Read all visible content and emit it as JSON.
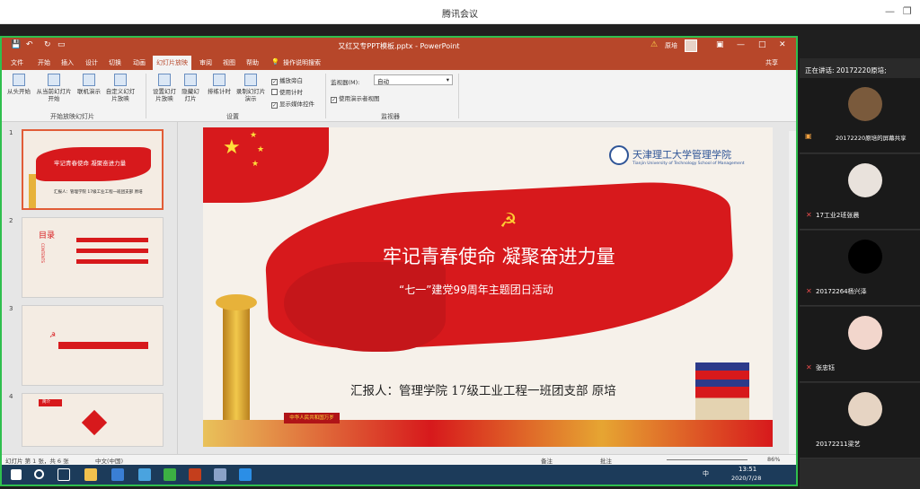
{
  "window": {
    "title": "腾讯会议",
    "minimize_icon": "minimize-icon",
    "restore_icon": "restore-icon"
  },
  "ppt": {
    "doc_title": "又红又专PPT模板.pptx - PowerPoint",
    "user": "原培",
    "share": "共享",
    "tell_me": "操作说明搜索",
    "tabs": [
      "文件",
      "开始",
      "插入",
      "设计",
      "切换",
      "动画",
      "幻灯片放映",
      "审阅",
      "视图",
      "帮助"
    ],
    "active_tab": "幻灯片放映",
    "ribbon": {
      "from_start": "从头开始",
      "from_current": "从当前幻灯片开始",
      "online": "联机演示",
      "custom": "自定义幻灯片放映",
      "group1": "开始放映幻灯片",
      "setup": "设置幻灯片放映",
      "hide": "隐藏幻灯片",
      "rehearse": "排练计时",
      "record": "录制幻灯片演示",
      "cb_narration": "播放旁白",
      "cb_timing": "使用计时",
      "cb_media": "显示媒体控件",
      "group2": "设置",
      "monitor_label": "监视器(M):",
      "monitor_value": "自动",
      "presenter_view": "使用演示者视图",
      "group3": "监视器"
    },
    "thumb_numbers": [
      "1",
      "2",
      "3",
      "4"
    ],
    "thumb1_title": "牢记青春使命  凝聚奋进力量",
    "thumb1_sub": "汇报人：管理学院  17级工业工程一班团支部  原培",
    "thumb2_label": "目录",
    "thumb2_sub": "CONTENTS",
    "thumb4_label": "简介",
    "slide": {
      "logo_text": "天津理工大学管理学院",
      "logo_sub": "Tianjin University of Technology School of Management",
      "title": "牢记青春使命    凝聚奋进力量",
      "subtitle": "“七一”建党99周年主题团日活动",
      "reporter": "汇报人：管理学院  17级工业工程一班团支部  原培",
      "banner": "中华人民共和国万岁"
    },
    "status": {
      "slide_info": "幻灯片 第 1 张，共 6 张",
      "lang": "中文(中国)",
      "notes": "备注",
      "comments": "批注",
      "zoom": "86%"
    },
    "clock": {
      "time": "13:51",
      "date": "2020/7/28",
      "ime": "中"
    }
  },
  "meeting": {
    "speaking": "正在讲话: 20172220原培;",
    "participants": [
      {
        "name": "20172220原培的屏幕共享"
      },
      {
        "name": "17工业2班张晨"
      },
      {
        "name": "20172264杨兴泽"
      },
      {
        "name": "张忠钰"
      },
      {
        "name": "20172211梁艺"
      }
    ]
  },
  "colors": {
    "ppt_red": "#b7472a",
    "share_border": "#2fbf4e",
    "slide_red": "#d7191c",
    "gold": "#e7b23a"
  }
}
